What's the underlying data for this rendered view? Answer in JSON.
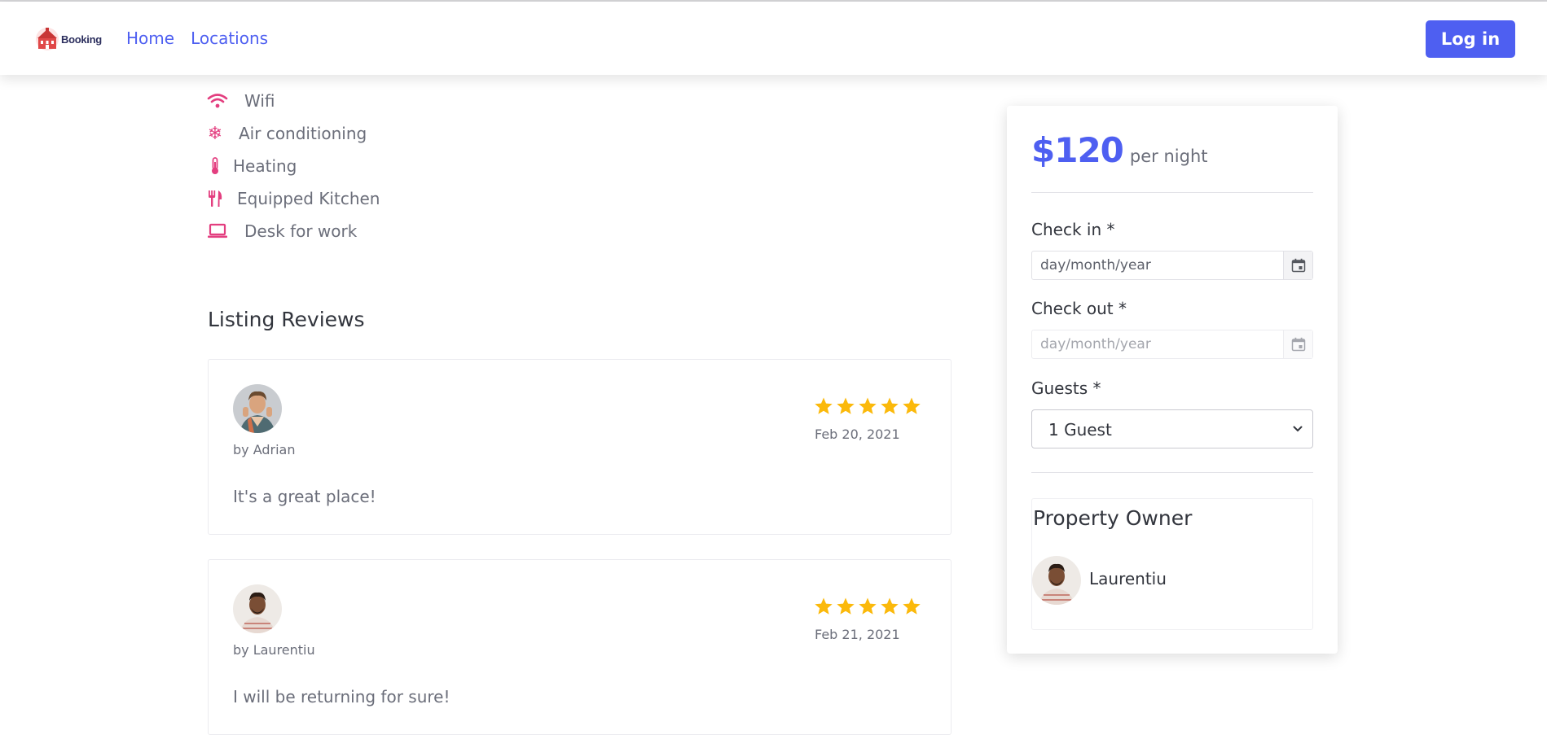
{
  "brand": {
    "logo_text": "Booking"
  },
  "nav": {
    "items": [
      "Home",
      "Locations"
    ],
    "login_label": "Log in"
  },
  "amenities": [
    {
      "label": "Wifi",
      "icon": "wifi-icon"
    },
    {
      "label": "Air conditioning",
      "icon": "snowflake-icon"
    },
    {
      "label": "Heating",
      "icon": "thermometer-icon"
    },
    {
      "label": "Equipped Kitchen",
      "icon": "utensils-icon"
    },
    {
      "label": "Desk for work",
      "icon": "laptop-icon"
    }
  ],
  "reviews": {
    "title": "Listing Reviews",
    "items": [
      {
        "author": "by Adrian",
        "date": "Feb 20, 2021",
        "rating": 5,
        "text": "It's a great place!"
      },
      {
        "author": "by Laurentiu",
        "date": "Feb 21, 2021",
        "rating": 5,
        "text": "I will be returning for sure!"
      }
    ]
  },
  "booking": {
    "price": "$120",
    "price_unit": "per night",
    "check_in_label": "Check in *",
    "check_in_placeholder": "day/month/year",
    "check_out_label": "Check out *",
    "check_out_placeholder": "day/month/year",
    "guests_label": "Guests *",
    "guests_value": "1 Guest"
  },
  "owner": {
    "title": "Property Owner",
    "name": "Laurentiu"
  },
  "colors": {
    "accent": "#4e5ff1",
    "amenity_icon": "#e33e7f",
    "star": "#fbb90b",
    "text": "#6b6e7a",
    "heading": "#32353d"
  }
}
